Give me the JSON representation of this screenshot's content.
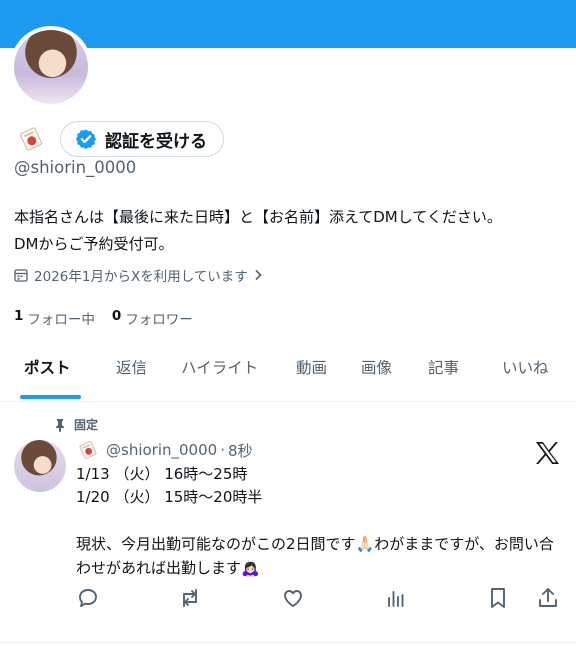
{
  "profile": {
    "name_emoji": "seal-stamp",
    "verify_label": "認証を受ける",
    "handle": "@shiorin_0000",
    "bio_line1": "本指名さんは【最後に来た日時】と【お名前】添えてDMしてください。",
    "bio_line2": "DMからご予約受付可。",
    "joined": "2026年1月からXを利用しています",
    "following_count": "1",
    "following_label": "フォロー中",
    "followers_count": "0",
    "followers_label": "フォロワー"
  },
  "tabs": [
    {
      "label": "ポスト",
      "active": true
    },
    {
      "label": "返信"
    },
    {
      "label": "ハイライト"
    },
    {
      "label": "動画"
    },
    {
      "label": "画像"
    },
    {
      "label": "記事"
    },
    {
      "label": "いいね"
    }
  ],
  "post": {
    "pinned_label": "固定",
    "handle": "@shiorin_0000",
    "separator": "·",
    "time": "8秒",
    "line1": "1/13 （火） 16時〜25時",
    "line2": "1/20 （火） 15時〜20時半",
    "para": "現状、今月出勤可能なのがこの2日間です🙏🏻わがままですが、お問い合わせがあれば出勤します🙇🏻‍♀️"
  },
  "icons": {
    "verified": "verified-badge-icon",
    "calendar": "calendar-icon",
    "pin": "pin-icon",
    "x_logo": "x-logo-icon",
    "actions": [
      "reply-icon",
      "repost-icon",
      "like-icon",
      "views-icon",
      "bookmark-icon",
      "share-icon"
    ]
  },
  "colors": {
    "accent": "#1d9bf0",
    "text": "#0f1419",
    "muted": "#536471"
  }
}
